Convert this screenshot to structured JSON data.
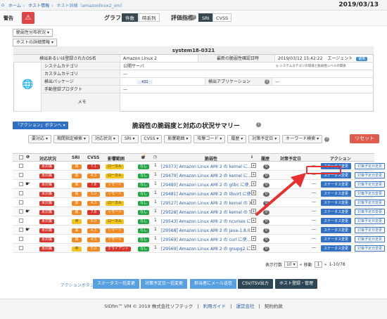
{
  "breadcrumb": [
    "ホーム",
    "ホスト情報",
    "ホスト詳細（amazonlinux2_vm）"
  ],
  "date": "2019/03/13",
  "alert": {
    "label": "警告",
    "icon": "⚠"
  },
  "graph": {
    "label": "グラフ",
    "opts": [
      "件数",
      "時系列"
    ],
    "selected": "件数"
  },
  "eval": {
    "label": "評価指標",
    "opts": [
      "SRI",
      "CVSS"
    ],
    "selected": "SRI"
  },
  "dropdowns": [
    "脆弱性分布状況",
    "ホストの詳細情報"
  ],
  "host": {
    "name": "system18-0321",
    "os_label": "検出あるいは登録されたOS名",
    "os_value": "Amazon Linux 2",
    "last_label": "最新の脆弱性確認日時",
    "last_value": "2019/03/12 15:42:22",
    "agent_label": "エージェント",
    "agent_badge": "使用",
    "sys_cat_label": "システムカテゴリ",
    "sys_cat_value": "公開サーバ",
    "sys_cat_note": "◎ システムカテゴリの環境と脆弱性レベルの関係",
    "custom_cat_label": "カスタムカテゴリ",
    "custom_cat_value": "—",
    "pkg_label": "検出パッケージ",
    "pkg_value": "432",
    "app_label": "検出アプリケーション",
    "app_value": "—",
    "product_label": "手動登録プロダクト",
    "product_value": "—",
    "memo_label": "メモ",
    "memo_value": ""
  },
  "action_dropdown": "「アクション」ボタンへ",
  "section_title": "脆弱性の脆弱度と対応の状況サマリー",
  "filters": [
    "要対応",
    "期間指定検索",
    "対応状況",
    "SRI",
    "CVSS",
    "影響範囲",
    "攻撃コード",
    "履歴",
    "対策予定日",
    "キーワード検索"
  ],
  "reset_label": "リセット",
  "columns": [
    "",
    "",
    "対応状況",
    "SRI",
    "CVSS",
    "影響範囲",
    "",
    "",
    "脆弱性",
    "",
    "履歴",
    "対策予定日",
    "アクション"
  ],
  "rows": [
    {
      "flag": "",
      "status": "未対策",
      "sri": "高",
      "cvss": "7.1",
      "scope": "ローカル",
      "exploit": "なし",
      "count": "1",
      "vuln": "[29373] Amazon Linux AMI 2 の kernel に...",
      "hist": "0",
      "plan": "—"
    },
    {
      "flag": "",
      "status": "未対策",
      "sri": "高",
      "cvss": "4.3",
      "scope": "ローカル",
      "exploit": "なし",
      "count": "1",
      "vuln": "[29479] Amazon Linux AMI 2 の kernel に...",
      "hist": "0",
      "plan": "—"
    },
    {
      "flag": "☛",
      "status": "未対策",
      "sri": "高",
      "cvss": "7.8",
      "scope": "リモート",
      "exploit": "なし",
      "count": "1",
      "vuln": "[29480] Amazon Linux AMI 2 の glibc に使...",
      "hist": "0",
      "plan": "—"
    },
    {
      "flag": "",
      "status": "未対策",
      "sri": "高",
      "cvss": "5.0",
      "scope": "リモート",
      "exploit": "なし",
      "count": "1",
      "vuln": "[29481] Amazon Linux AMI 2 の libvirt に使...",
      "hist": "0",
      "plan": "—"
    },
    {
      "flag": "",
      "status": "未対策",
      "sri": "高",
      "cvss": "4.3",
      "scope": "ローカル",
      "exploit": "なし",
      "count": "1",
      "vuln": "[29527] Amazon Linux AMI 2 の kernel の X...",
      "hist": "0",
      "plan": "—"
    },
    {
      "flag": "☛",
      "status": "未対策",
      "sri": "高",
      "cvss": "7.8",
      "scope": "リモート",
      "exploit": "なし",
      "count": "1",
      "vuln": "[29528] Amazon Linux AMI 2 の kernel の T...",
      "hist": "0",
      "plan": "—"
    },
    {
      "flag": "",
      "status": "未対策",
      "sri": "中",
      "cvss": "5.0",
      "scope": "ローカル",
      "exploit": "なし",
      "count": "1",
      "vuln": "[29543] Amazon Linux AMI 2 の ncurses に...",
      "hist": "0",
      "plan": "—"
    },
    {
      "flag": "☛",
      "status": "未対策",
      "sri": "高",
      "cvss": "4.3",
      "scope": "リモート",
      "exploit": "なし",
      "count": "1",
      "vuln": "[29568] Amazon Linux AMI 2 の java-1.8.0...",
      "hist": "0",
      "plan": "—"
    },
    {
      "flag": "",
      "status": "未対策",
      "sri": "高",
      "cvss": "4.3",
      "scope": "リモート",
      "exploit": "なし",
      "count": "1",
      "vuln": "[29569] Amazon Linux AMI 2 の curl に使...",
      "hist": "0",
      "plan": "—"
    },
    {
      "flag": "",
      "status": "未対策",
      "sri": "中",
      "cvss": "5.0",
      "scope": "クライアント",
      "exploit": "なし",
      "count": "1",
      "vuln": "[29569] Amazon Linux AMI 2 の gnupg2 に...",
      "hist": "0",
      "plan": "—"
    }
  ],
  "action_status": "ステータス変更",
  "action_plan": "対策予定日変更",
  "pagination": {
    "label": "表示行数",
    "rows": "10",
    "move": "移動",
    "page": "1",
    "range": "1-10/78"
  },
  "bottom_label": "アクションボタン",
  "bottom_buttons": [
    "ステータス一括変更",
    "対策予定日一括変更",
    "担当者にメール送信",
    "CSV/TSV出力",
    "ホスト登録・管理"
  ],
  "footer": [
    "SIDfm™ VM © 2019 株式会社ソフテック",
    "利用ガイド",
    "運営会社",
    "契約約款"
  ],
  "colors": {
    "accent": "#2f6fc4",
    "danger": "#d9342b",
    "arrow": "#e8312e"
  }
}
